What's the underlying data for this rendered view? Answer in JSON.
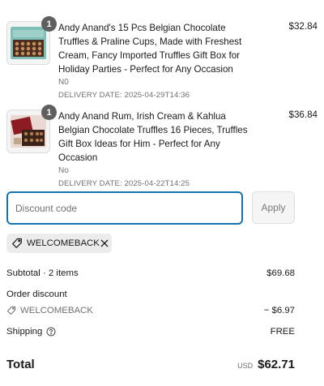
{
  "items": [
    {
      "quantity": "1",
      "title": "Andy Anand's 15 Pcs Belgian Chocolate Truffles & Praline Cups, Made with Freshest Cream, Fancy Imported Truffles Gift Box for Holiday Parties - Perfect for Any Occasion",
      "variant": "N0",
      "delivery": "DELIVERY DATE: 2025-04-29T14:36",
      "price": "$32.84",
      "image": "chocolate-truffle-box-image"
    },
    {
      "quantity": "1",
      "title": "Andy Anand Rum, Irish Cream & Kahlua Belgian Chocolate Truffles 16 Pieces, Truffles Gift Box Ideas for Him - Perfect for Any Occasion",
      "variant": "No",
      "delivery": "DELIVERY DATE: 2025-04-22T14:25",
      "price": "$36.84",
      "image": "liqueur-truffles-gift-box-image"
    }
  ],
  "discount": {
    "placeholder": "Discount code",
    "apply_label": "Apply",
    "applied_code": "WELCOMEBACK",
    "tag_icon": "tag-icon",
    "remove_icon": "close-icon"
  },
  "summary": {
    "subtotal_label": "Subtotal · 2 items",
    "subtotal_value": "$69.68",
    "order_discount_label": "Order discount",
    "discount_code": "WELCOMEBACK",
    "discount_value": "− $6.97",
    "shipping_label": "Shipping",
    "shipping_help_icon": "question-circle-icon",
    "shipping_value": "FREE",
    "total_label": "Total",
    "currency": "USD",
    "total_value": "$62.71"
  },
  "colors": {
    "focus_border": "#1773b0",
    "quantity_badge": "#5f5f5f",
    "tag_background": "#ececec"
  }
}
